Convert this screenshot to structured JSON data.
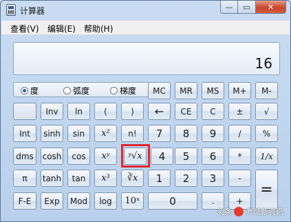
{
  "window": {
    "title": "计算器"
  },
  "caption": {
    "minimize": "—",
    "maximize": "▭",
    "close": "✕"
  },
  "menu": [
    "查看(V)",
    "编辑(E)",
    "帮助(H)"
  ],
  "display": {
    "value": "16"
  },
  "angle_modes": [
    {
      "label": "度",
      "selected": true
    },
    {
      "label": "弧度",
      "selected": false
    },
    {
      "label": "梯度",
      "selected": false
    }
  ],
  "memory_buttons": [
    "MC",
    "MR",
    "MS",
    "M+",
    "M-"
  ],
  "rows": {
    "r1": [
      "",
      "Inv",
      "ln",
      "(",
      ")",
      "←",
      "CE",
      "C",
      "±",
      "√"
    ],
    "r2": [
      "Int",
      "sinh",
      "sin",
      "x²",
      "n!",
      "7",
      "8",
      "9",
      "/",
      "%"
    ],
    "r3": [
      "dms",
      "cosh",
      "cos",
      "xʸ",
      "ʸ√x",
      "4",
      "5",
      "6",
      "*",
      "1/x"
    ],
    "r4": [
      "π",
      "tanh",
      "tan",
      "x³",
      "∛x",
      "1",
      "2",
      "3",
      "-",
      "="
    ],
    "r5": [
      "F-E",
      "Exp",
      "Mod",
      "log",
      "10ˣ",
      "0",
      ".",
      "+"
    ]
  },
  "watermark": {
    "prefix": "头条",
    "text": "考试新资讯"
  }
}
